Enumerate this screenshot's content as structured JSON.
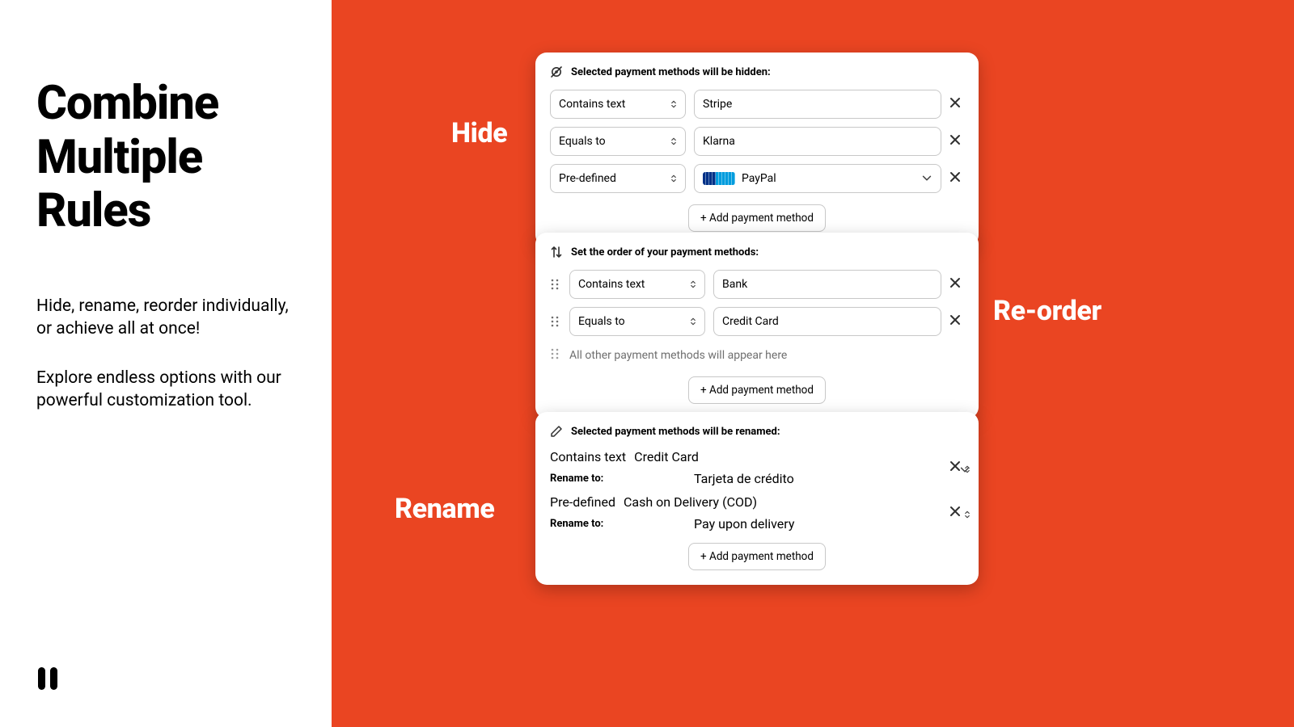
{
  "left": {
    "headline_l1": "Combine",
    "headline_l2": "Multiple",
    "headline_l3": "Rules",
    "sub1": "Hide, rename, reorder individually, or achieve all at once!",
    "sub2": "Explore endless options with our powerful customization tool."
  },
  "tags": {
    "hide": "Hide",
    "reorder": "Re-order",
    "rename": "Rename"
  },
  "shared": {
    "add_button": "+ Add payment method",
    "rename_to": "Rename to:"
  },
  "hide": {
    "title": "Selected payment methods will be hidden:",
    "rows": [
      {
        "condition": "Contains text",
        "value": "Stripe",
        "type": "text"
      },
      {
        "condition": "Equals to",
        "value": "Klarna",
        "type": "text"
      },
      {
        "condition": "Pre-defined",
        "value": "PayPal",
        "type": "dropdown_paypal"
      }
    ]
  },
  "reorder": {
    "title": "Set the order of your payment methods:",
    "rows": [
      {
        "condition": "Contains text",
        "value": "Bank"
      },
      {
        "condition": "Equals to",
        "value": "Credit Card"
      }
    ],
    "ghost": "All other payment methods will appear here"
  },
  "rename": {
    "title": "Selected payment methods will be renamed:",
    "rows": [
      {
        "condition": "Contains text",
        "value": "Credit Card",
        "type": "dropdown",
        "rename_to": "Tarjeta de crédito"
      },
      {
        "condition": "Pre-defined",
        "value": "Cash on Delivery (COD)",
        "type": "text",
        "rename_to": "Pay upon delivery"
      }
    ]
  }
}
